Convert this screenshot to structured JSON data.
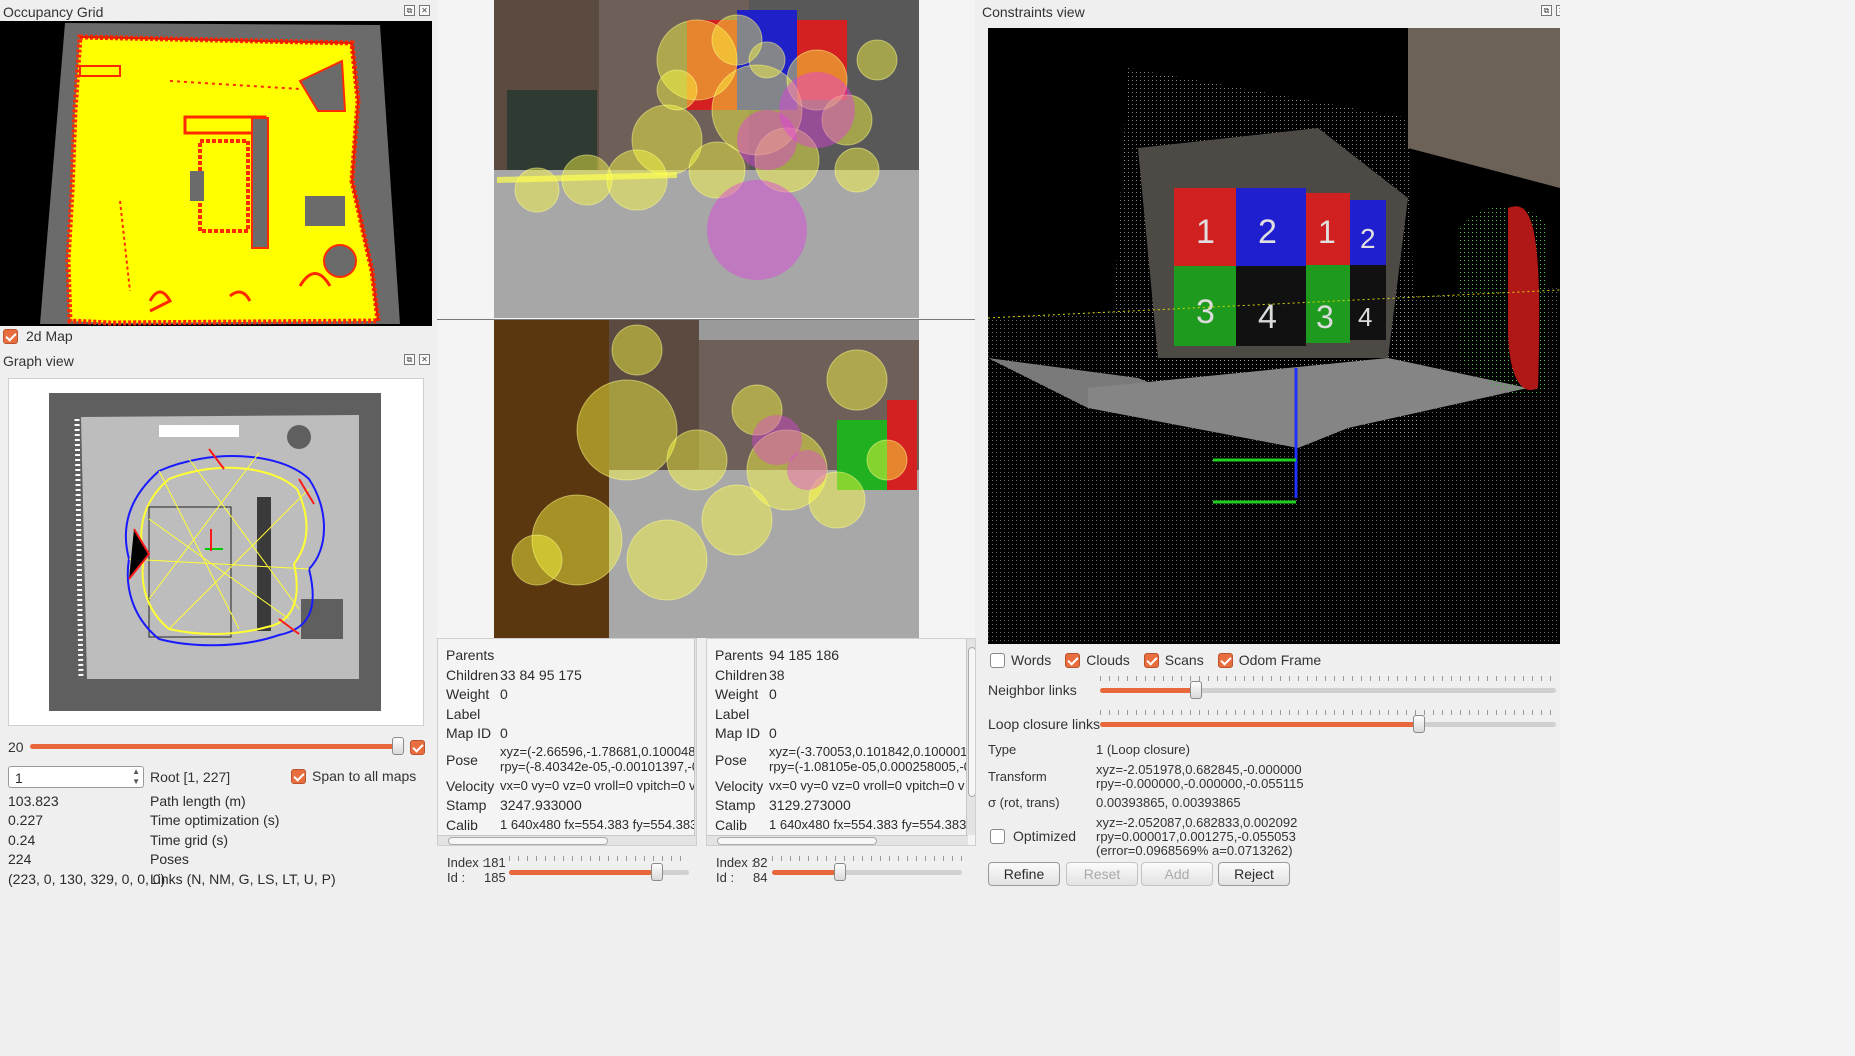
{
  "occupancy": {
    "title": "Occupancy Grid",
    "map_checkbox_label": "2d Map",
    "map_checked": true
  },
  "graph": {
    "title": "Graph view",
    "slider_value": "20",
    "slider_fraction": 0.99,
    "slider_checked": true,
    "spin_value": "1",
    "root_label": "Root [1, 227]",
    "span_label": "Span to all maps",
    "span_checked": true,
    "stats": [
      {
        "value": "103.823",
        "label": "Path length (m)"
      },
      {
        "value": "0.227",
        "label": "Time optimization (s)"
      },
      {
        "value": "0.24",
        "label": "Time grid (s)"
      },
      {
        "value": "224",
        "label": "Poses"
      },
      {
        "value": "(223, 0, 130, 329, 0, 0, 0)",
        "label": "Links (N, NM, G, LS, LT, U, P)"
      }
    ]
  },
  "left_info": {
    "rows": [
      {
        "key": "Parents",
        "value": ""
      },
      {
        "key": "Children",
        "value": "33 84 95 175"
      },
      {
        "key": "Weight",
        "value": "0"
      },
      {
        "key": "Label",
        "value": ""
      },
      {
        "key": "Map ID",
        "value": "0"
      },
      {
        "key": "Pose",
        "value": "xyz=(-2.66596,-1.78681,0.100048)",
        "value2": "rpy=(-8.40342e-05,-0.00101397,-0"
      },
      {
        "key": "Velocity",
        "value": "vx=0 vy=0 vz=0 vroll=0 vpitch=0 v"
      },
      {
        "key": "Stamp",
        "value": "3247.933000"
      },
      {
        "key": "Calib",
        "value": "1 640x480 fx=554.383 fy=554.383"
      }
    ],
    "index_label": "Index :",
    "index_value": "181",
    "id_label": "Id :",
    "id_value": "185",
    "slider_fraction": 0.82
  },
  "right_info": {
    "rows": [
      {
        "key": "Parents",
        "value": "94 185 186"
      },
      {
        "key": "Children",
        "value": "38"
      },
      {
        "key": "Weight",
        "value": "0"
      },
      {
        "key": "Label",
        "value": ""
      },
      {
        "key": "Map ID",
        "value": "0"
      },
      {
        "key": "Pose",
        "value": "xyz=(-3.70053,0.101842,0.100001",
        "value2": "rpy=(-1.08105e-05,0.000258005,-0"
      },
      {
        "key": "Velocity",
        "value": "vx=0 vy=0 vz=0 vroll=0 vpitch=0 v"
      },
      {
        "key": "Stamp",
        "value": "3129.273000"
      },
      {
        "key": "Calib",
        "value": "1 640x480 fx=554.383 fy=554.383"
      }
    ],
    "index_label": "Index :",
    "index_value": "82",
    "id_label": "Id :",
    "id_value": "84",
    "slider_fraction": 0.36
  },
  "constraints": {
    "title": "Constraints view",
    "checkboxes": [
      {
        "label": "Words",
        "checked": false
      },
      {
        "label": "Clouds",
        "checked": true
      },
      {
        "label": "Scans",
        "checked": true
      },
      {
        "label": "Odom Frame",
        "checked": true
      }
    ],
    "neighbor_label": "Neighbor links",
    "neighbor_fraction": 0.21,
    "loop_label": "Loop closure links",
    "loop_fraction": 0.7,
    "type_key": "Type",
    "type_value": "1 (Loop closure)",
    "transform_key": "Transform",
    "transform_value1": "xyz=-2.051978,0.682845,-0.000000",
    "transform_value2": "rpy=-0.000000,-0.000000,-0.055115",
    "sigma_key": "σ (rot, trans)",
    "sigma_value": "0.00393865, 0.00393865",
    "optimized_label": "Optimized",
    "optimized_checked": false,
    "optimized_value1": "xyz=-2.052087,0.682833,0.002092",
    "optimized_value2": "rpy=0.000017,0.001275,-0.055053",
    "optimized_value3": "(error=0.0968569% a=0.0713262)",
    "buttons": {
      "refine": "Refine",
      "reset": "Reset",
      "add": "Add",
      "reject": "Reject"
    },
    "cube_labels": [
      "1",
      "2",
      "1",
      "2",
      "3",
      "4",
      "3",
      "4"
    ]
  },
  "colors": {
    "accent": "#e8683b",
    "map_fill": "#ffff00",
    "map_edge": "#ff2a00",
    "graph_blue": "#1a1aff",
    "graph_yellow": "#ffff33",
    "graph_red": "#ff1a1a"
  }
}
